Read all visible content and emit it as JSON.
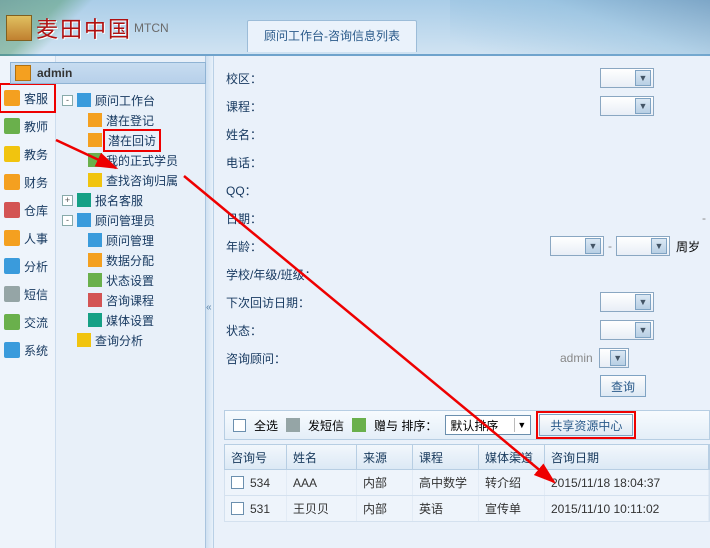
{
  "brand": {
    "name": "麦田中国",
    "sub": "MTCN"
  },
  "tab": {
    "title": "顾问工作台-咨询信息列表"
  },
  "user": "admin",
  "iconbar": [
    {
      "label": "客服",
      "hl": true
    },
    {
      "label": "教师"
    },
    {
      "label": "教务"
    },
    {
      "label": "财务"
    },
    {
      "label": "仓库"
    },
    {
      "label": "人事"
    },
    {
      "label": "分析"
    },
    {
      "label": "短信"
    },
    {
      "label": "交流"
    },
    {
      "label": "系统"
    }
  ],
  "tree": {
    "root1": "顾问工作台",
    "c1": "潜在登记",
    "c2": "潜在回访",
    "c3": "我的正式学员",
    "c4": "查找咨询归属",
    "root2": "报名客服",
    "root3": "顾问管理员",
    "c5": "顾问管理",
    "c6": "数据分配",
    "c7": "状态设置",
    "c8": "咨询课程",
    "c9": "媒体设置",
    "root4": "查询分析"
  },
  "form": {
    "campus": "校区：",
    "course": "课程：",
    "name": "姓名：",
    "phone": "电话：",
    "qq": "QQ：",
    "date": "日期：",
    "age": "年龄：",
    "age_unit": "周岁",
    "grade": "学校/年级/班级：",
    "next_visit": "下次回访日期：",
    "status": "状态：",
    "advisor": "咨询顾问：",
    "advisor_value": "admin",
    "query_btn": "查询"
  },
  "toolbar": {
    "select_all": "全选",
    "sms": "发短信",
    "gift": "赠与 排序：",
    "sort_value": "默认排序",
    "share": "共享资源中心"
  },
  "grid": {
    "headers": {
      "h0": "咨询号",
      "h1": "姓名",
      "h2": "来源",
      "h3": "课程",
      "h4": "媒体渠道",
      "h5": "咨询日期"
    },
    "rows": [
      {
        "id": "534",
        "name": "AAA",
        "src": "内部",
        "course": "高中数学",
        "media": "转介绍",
        "date": "2015/11/18 18:04:37"
      },
      {
        "id": "531",
        "name": "王贝贝",
        "src": "内部",
        "course": "英语",
        "media": "宣传单",
        "date": "2015/11/10 10:11:02"
      }
    ]
  }
}
